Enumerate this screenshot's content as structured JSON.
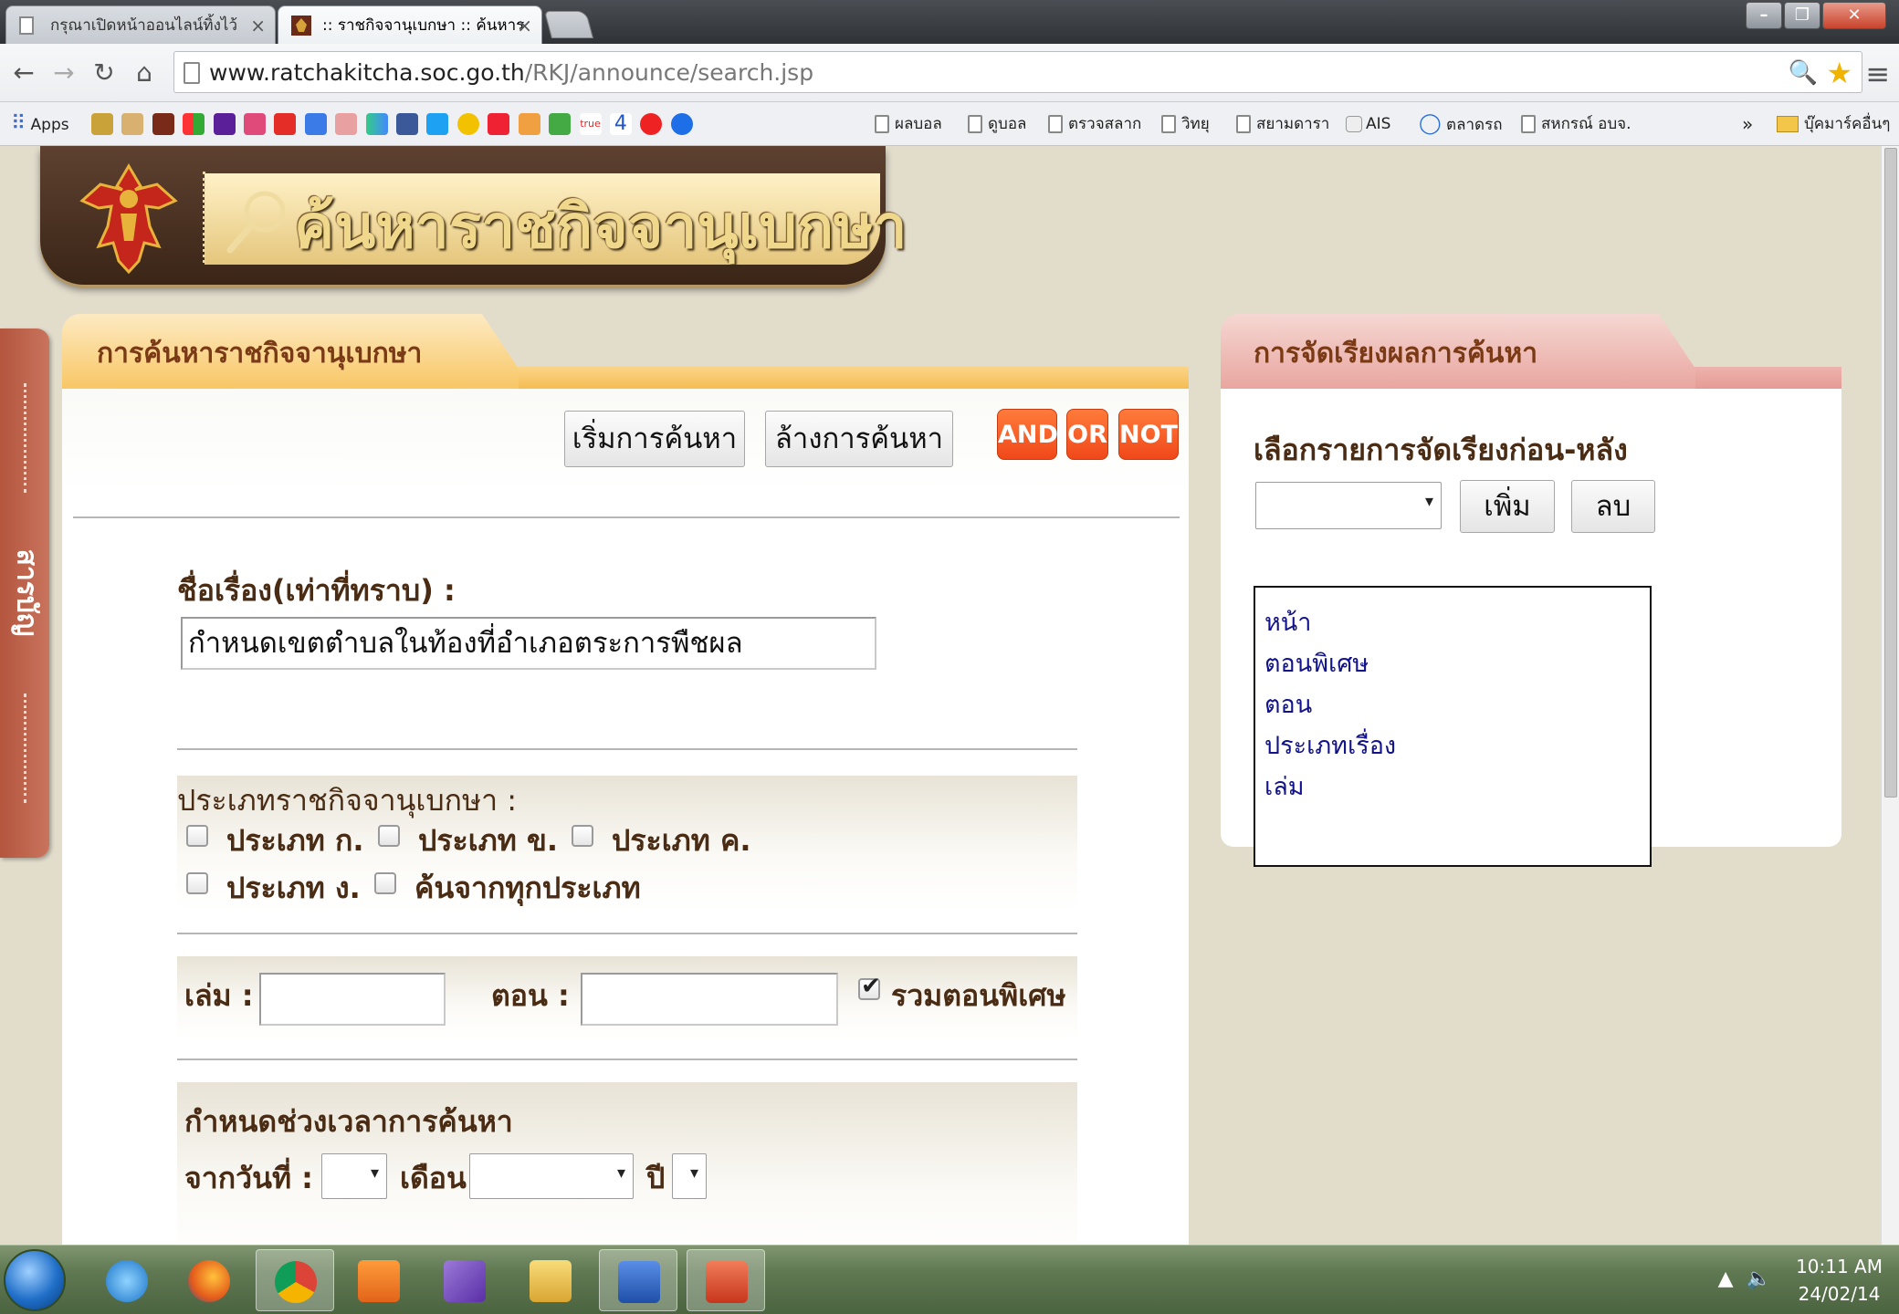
{
  "tabs": [
    {
      "title": "กรุณาเปิดหน้าออนไลน์ทิ้งไว้",
      "close": "×"
    },
    {
      "title": ":: ราชกิจจานุเบกษา :: ค้นหาร",
      "close": "×"
    }
  ],
  "address": {
    "domain": "www.ratchakitcha.soc.go.th",
    "path": "/RKJ/announce/search.jsp"
  },
  "bookmarks": {
    "apps": "Apps",
    "items": [
      "ผลบอล",
      "ดูบอล",
      "ตรวจสลาก",
      "วิทยุ",
      "สยามดารา",
      "AIS",
      "ตลาดรถ",
      "สหกรณ์ อบจ."
    ],
    "overflow": "»",
    "folder": "บุ๊คมาร์คอื่นๆ"
  },
  "banner": {
    "title": "ค้นหาราชกิจจานุเบกษา"
  },
  "side_tab": {
    "label": "สารบัญ"
  },
  "search": {
    "tab_title": "การค้นหาราชกิจจานุเบกษา",
    "start_button": "เริ่มการค้นหา",
    "clear_button": "ล้างการค้นหา",
    "operators": [
      "AND",
      "OR",
      "NOT"
    ],
    "title_label": "ชื่อเรื่อง(เท่าที่ทราบ) :",
    "title_value": "กำหนดเขตตำบลในท้องที่อำเภอตระการพืชผล",
    "type_label": "ประเภทราชกิจจานุเบกษา :",
    "types": [
      {
        "label": "ประเภท ก.",
        "checked": false
      },
      {
        "label": "ประเภท ข.",
        "checked": false
      },
      {
        "label": "ประเภท ค.",
        "checked": false
      },
      {
        "label": "ประเภท ง.",
        "checked": false
      },
      {
        "label": "ค้นจากทุกประเภท",
        "checked": false
      }
    ],
    "volume_label": "เล่ม :",
    "volume_value": "",
    "issue_label": "ตอน :",
    "issue_value": "",
    "include_special_label": "รวมตอนพิเศษ",
    "include_special_checked": true,
    "period_label": "กำหนดช่วงเวลาการค้นหา",
    "from_date_label": "จากวันที่ :",
    "month_label": "เดือน",
    "year_label": "ปี"
  },
  "sort": {
    "tab_title": "การจัดเรียงผลการค้นหา",
    "select_label": "เลือกรายการจัดเรียงก่อน-หลัง",
    "add_button": "เพิ่ม",
    "remove_button": "ลบ",
    "options": [
      "หน้า",
      "ตอนพิเศษ",
      "ตอน",
      "ประเภทเรื่อง",
      "เล่ม"
    ]
  },
  "taskbar": {
    "time": "10:11 AM",
    "date": "24/02/14"
  },
  "colors": {
    "accent_orange": "#f0481a",
    "panel_orange": "#f8c765",
    "panel_pink": "#e9a6a0",
    "link_blue": "#12128a",
    "banner_brown": "#3a2517"
  }
}
